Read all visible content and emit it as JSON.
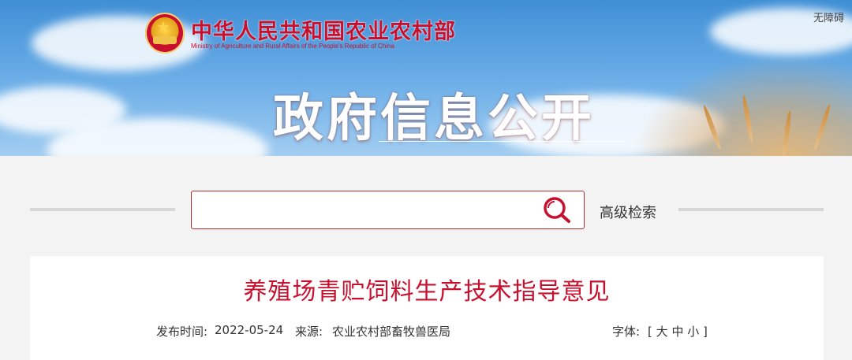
{
  "header": {
    "ministry_cn": "中华人民共和国农业农村部",
    "ministry_en": "Ministry of Agriculture and Rural Affairs of the People's Republic of China",
    "accessibility_label": "无障碍",
    "section_title": "政府信息公开"
  },
  "search": {
    "value": "",
    "advanced_label": "高级检索",
    "icon": "search-icon"
  },
  "article": {
    "title": "养殖场青贮饲料生产技术指导意见",
    "date_label": "发布时间:",
    "date": "2022-05-24",
    "source_label": "来源:",
    "source": "农业农村部畜牧兽医局",
    "font_label": "字体:",
    "font_open": "[",
    "font_large": "大",
    "font_medium": "中",
    "font_small": "小",
    "font_close": "]"
  },
  "colors": {
    "accent_red": "#c8102e",
    "search_border": "#b52a2a"
  }
}
